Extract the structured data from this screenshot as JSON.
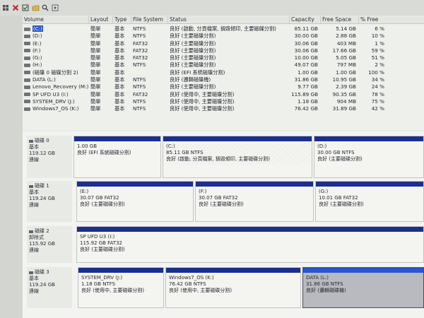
{
  "toolbar": {
    "icons": [
      "grid-icon",
      "close-icon",
      "check-icon",
      "folder-icon",
      "search-icon",
      "zoom-icon"
    ]
  },
  "volume_list": {
    "columns": [
      "Volume",
      "Layout",
      "Type",
      "File System",
      "Status",
      "Capacity",
      "Free Space",
      "% Free"
    ],
    "rows": [
      {
        "volume": "(C:)",
        "layout": "簡單",
        "type": "基本",
        "fs": "NTFS",
        "status": "良好 (啟動, 分頁檔案, 損毀傾印, 主要磁碟分割)",
        "capacity": "85.11 GB",
        "free": "5.14 GB",
        "pct": "6 %"
      },
      {
        "volume": "(D:)",
        "layout": "簡單",
        "type": "基本",
        "fs": "NTFS",
        "status": "良好 (主要磁碟分割)",
        "capacity": "30.00 GB",
        "free": "2.88 GB",
        "pct": "10 %"
      },
      {
        "volume": "(E:)",
        "layout": "簡單",
        "type": "基本",
        "fs": "FAT32",
        "status": "良好 (主要磁碟分割)",
        "capacity": "30.06 GB",
        "free": "403 MB",
        "pct": "1 %"
      },
      {
        "volume": "(F:)",
        "layout": "簡單",
        "type": "基本",
        "fs": "FAT32",
        "status": "良好 (主要磁碟分割)",
        "capacity": "30.06 GB",
        "free": "17.66 GB",
        "pct": "59 %"
      },
      {
        "volume": "(G:)",
        "layout": "簡單",
        "type": "基本",
        "fs": "FAT32",
        "status": "良好 (主要磁碟分割)",
        "capacity": "10.00 GB",
        "free": "5.05 GB",
        "pct": "51 %"
      },
      {
        "volume": "(H:)",
        "layout": "簡單",
        "type": "基本",
        "fs": "NTFS",
        "status": "良好 (主要磁碟分割)",
        "capacity": "49.07 GB",
        "free": "797 MB",
        "pct": "2 %"
      },
      {
        "volume": "(磁碟 0 磁碟分割 2)",
        "layout": "簡單",
        "type": "基本",
        "fs": "",
        "status": "良好 (EFI 系統磁碟分割)",
        "capacity": "1.00 GB",
        "free": "1.00 GB",
        "pct": "100 %"
      },
      {
        "volume": "DATA (L:)",
        "layout": "簡單",
        "type": "基本",
        "fs": "NTFS",
        "status": "良好 (邏輯磁碟機)",
        "capacity": "31.86 GB",
        "free": "10.95 GB",
        "pct": "34 %"
      },
      {
        "volume": "Lenovo_Recovery (M:)",
        "layout": "簡單",
        "type": "基本",
        "fs": "NTFS",
        "status": "良好 (主要磁碟分割)",
        "capacity": "9.77 GB",
        "free": "2.39 GB",
        "pct": "24 %"
      },
      {
        "volume": "SP UFD U3 (I:)",
        "layout": "簡單",
        "type": "基本",
        "fs": "FAT32",
        "status": "良好 (使用中, 主要磁碟分割)",
        "capacity": "115.89 GB",
        "free": "90.35 GB",
        "pct": "78 %"
      },
      {
        "volume": "SYSTEM_DRV (J:)",
        "layout": "簡單",
        "type": "基本",
        "fs": "NTFS",
        "status": "良好 (使用中, 主要磁碟分割)",
        "capacity": "1.18 GB",
        "free": "904 MB",
        "pct": "75 %"
      },
      {
        "volume": "Windows7_OS (K:)",
        "layout": "簡單",
        "type": "基本",
        "fs": "NTFS",
        "status": "良好 (使用中, 主要磁碟分割)",
        "capacity": "76.42 GB",
        "free": "31.89 GB",
        "pct": "42 %"
      }
    ]
  },
  "disks": [
    {
      "name": "磁碟 0",
      "kind": "基本",
      "size": "119.12 GB",
      "state": "連線",
      "partitions": [
        {
          "label": "",
          "size": "1.00 GB",
          "status": "良好 (EFI 系統磁碟分割)"
        },
        {
          "label": "(C:)",
          "size": "85.11 GB NTFS",
          "status": "良好 (啟動, 分頁檔案, 損毀傾印, 主要磁碟分割)"
        },
        {
          "label": "(D:)",
          "size": "30.00 GB NTFS",
          "status": "良好 (主要磁碟分割)"
        }
      ]
    },
    {
      "name": "磁碟 1",
      "kind": "基本",
      "size": "119.24 GB",
      "state": "連線",
      "partitions": [
        {
          "label": "(E:)",
          "size": "30.07 GB FAT32",
          "status": "良好 (主要磁碟分割)"
        },
        {
          "label": "(F:)",
          "size": "30.07 GB FAT32",
          "status": "良好 (主要磁碟分割)"
        },
        {
          "label": "(G:)",
          "size": "10.01 GB FAT32",
          "status": "良好 (主要磁碟分割)"
        }
      ]
    },
    {
      "name": "磁碟 2",
      "kind": "卸除式",
      "size": "115.92 GB",
      "state": "連線",
      "partitions": [
        {
          "label": "SP UFD U3  (I:)",
          "size": "115.92 GB FAT32",
          "status": "良好 (主要磁碟分割)"
        }
      ]
    },
    {
      "name": "磁碟 3",
      "kind": "基本",
      "size": "119.24 GB",
      "state": "連線",
      "partitions": [
        {
          "label": "SYSTEM_DRV  (J:)",
          "size": "1.18 GB NTFS",
          "status": "良好 (使用中, 主要磁碟分割)"
        },
        {
          "label": "Windows7_OS  (K:)",
          "size": "76.42 GB NTFS",
          "status": "良好 (使用中, 主要磁碟分割)"
        },
        {
          "label": "DATA  (L:)",
          "size": "31.86 GB NTFS",
          "status": "良好 (邏輯磁碟機)"
        }
      ]
    }
  ],
  "colors": {
    "partition_bar": "#1b2f8f",
    "selection": "#2a55c9"
  }
}
